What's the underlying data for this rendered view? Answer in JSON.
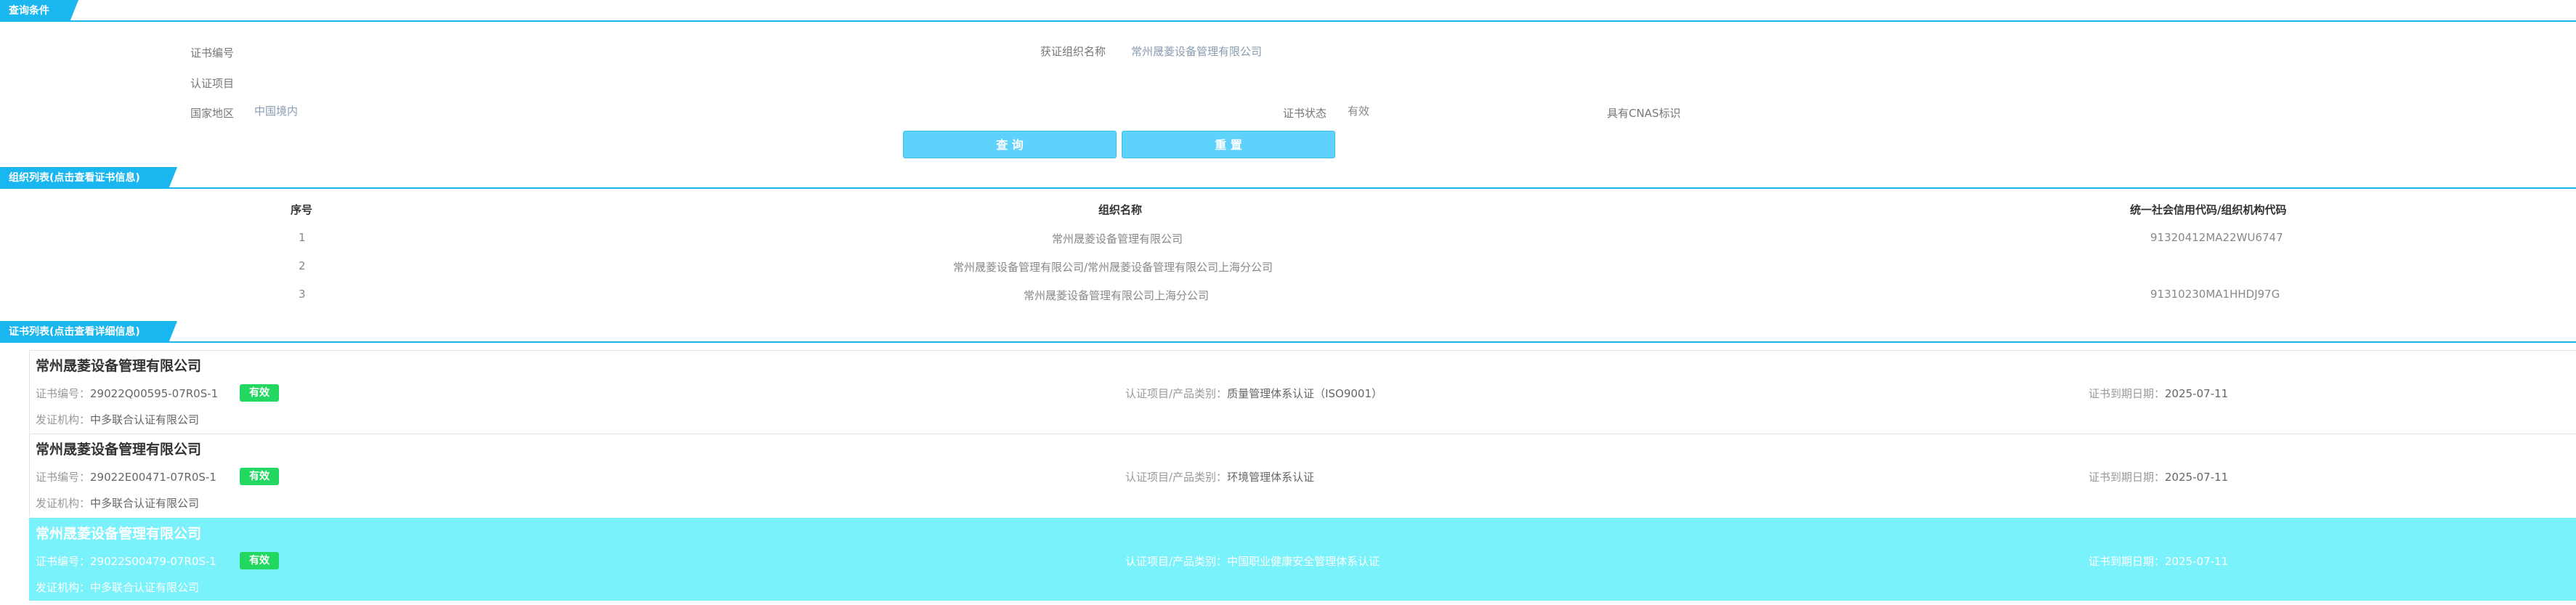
{
  "query_section": {
    "header": "查询条件",
    "cert_no_label": "证书编号",
    "org_name_label": "获证组织名称",
    "org_name_value": "常州晟菱设备管理有限公司",
    "cert_project_label": "认证项目",
    "region_label": "国家地区",
    "region_value": "中国境内",
    "status_label": "证书状态",
    "status_value": "有效",
    "cnas_label": "具有CNAS标识",
    "query_button": "查 询",
    "reset_button": "重 置"
  },
  "org_section": {
    "header": "组织列表(点击查看证书信息)",
    "columns": [
      "序号",
      "组织名称",
      "统一社会信用代码/组织机构代码"
    ],
    "rows": [
      {
        "idx": "1",
        "name": "常州晟菱设备管理有限公司",
        "code": "91320412MA22WU6747"
      },
      {
        "idx": "2",
        "name": "常州晟菱设备管理有限公司/常州晟菱设备管理有限公司上海分公司",
        "code": ""
      },
      {
        "idx": "3",
        "name": "常州晟菱设备管理有限公司上海分公司",
        "code": "91310230MA1HHDJ97G"
      }
    ]
  },
  "cert_section": {
    "header": "证书列表(点击查看详细信息)",
    "cards": [
      {
        "title": "常州晟菱设备管理有限公司",
        "cert_no_label": "证书编号：",
        "cert_no": "29022Q00595-07R0S-1",
        "status": "有效",
        "project_label": "认证项目/产品类别：",
        "project": "质量管理体系认证（ISO9001）",
        "expiry_label": "证书到期日期：",
        "expiry": "2025-07-11",
        "issuer_label": "发证机构：",
        "issuer": "中多联合认证有限公司"
      },
      {
        "title": "常州晟菱设备管理有限公司",
        "cert_no_label": "证书编号：",
        "cert_no": "29022E00471-07R0S-1",
        "status": "有效",
        "project_label": "认证项目/产品类别：",
        "project": "环境管理体系认证",
        "expiry_label": "证书到期日期：",
        "expiry": "2025-07-11",
        "issuer_label": "发证机构：",
        "issuer": "中多联合认证有限公司"
      },
      {
        "title": "常州晟菱设备管理有限公司",
        "cert_no_label": "证书编号：",
        "cert_no": "29022S00479-07R0S-1",
        "status": "有效",
        "project_label": "认证项目/产品类别：",
        "project": "中国职业健康安全管理体系认证",
        "expiry_label": "证书到期日期：",
        "expiry": "2025-07-11",
        "issuer_label": "发证机构：",
        "issuer": "中多联合认证有限公司"
      }
    ]
  },
  "colors": {
    "accent": "#1ab6ef",
    "button": "#5ed2fb",
    "active_card": "#7af2fb",
    "valid_badge": "#22d860"
  }
}
